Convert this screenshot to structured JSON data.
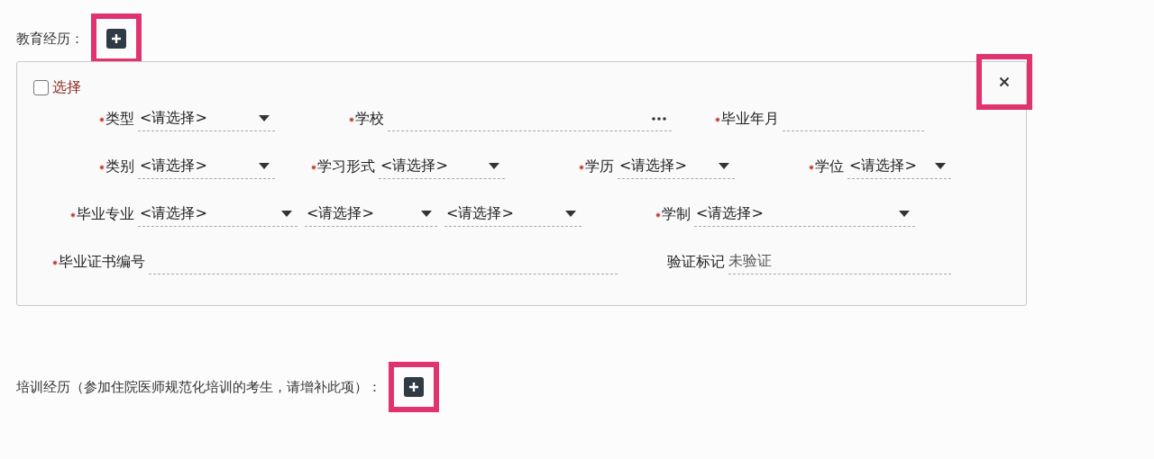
{
  "education": {
    "label": "教育经历：",
    "add_button": {
      "highlighted": true
    },
    "panel": {
      "close_button": {
        "highlighted": true
      },
      "select_checkbox": {
        "label": "选择",
        "checked": false
      },
      "rows": [
        {
          "fields": [
            {
              "label": "类型",
              "required": true,
              "controls": [
                {
                  "kind": "select",
                  "value": "<请选择>"
                }
              ]
            },
            {
              "label": "学校",
              "required": true,
              "controls": [
                {
                  "kind": "lookup"
                }
              ]
            },
            {
              "label": "毕业年月",
              "required": true,
              "controls": [
                {
                  "kind": "text"
                }
              ]
            }
          ]
        },
        {
          "fields": [
            {
              "label": "类别",
              "required": true,
              "controls": [
                {
                  "kind": "select",
                  "value": "<请选择>"
                }
              ]
            },
            {
              "label": "学习形式",
              "required": true,
              "controls": [
                {
                  "kind": "select",
                  "value": "<请选择>"
                }
              ]
            },
            {
              "label": "学历",
              "required": true,
              "controls": [
                {
                  "kind": "select",
                  "value": "<请选择>"
                }
              ]
            },
            {
              "label": "学位",
              "required": true,
              "controls": [
                {
                  "kind": "select",
                  "value": "<请选择>"
                }
              ]
            }
          ]
        },
        {
          "fields": [
            {
              "label": "毕业专业",
              "required": true,
              "controls": [
                {
                  "kind": "select",
                  "value": "<请选择>"
                },
                {
                  "kind": "select",
                  "value": "<请选择>"
                },
                {
                  "kind": "select",
                  "value": "<请选择>"
                }
              ]
            },
            {
              "label": "学制",
              "required": true,
              "controls": [
                {
                  "kind": "select",
                  "value": "<请选择>"
                }
              ]
            }
          ]
        },
        {
          "fields": [
            {
              "label": "毕业证书编号",
              "required": true,
              "controls": [
                {
                  "kind": "text"
                }
              ]
            },
            {
              "label": "验证标记",
              "required": false,
              "controls": [
                {
                  "kind": "static",
                  "value": "未验证"
                }
              ]
            }
          ]
        }
      ]
    }
  },
  "training": {
    "label": "培训经历（参加住院医师规范化培训的考生，请增补此项）：",
    "add_button": {
      "highlighted": true
    }
  }
}
